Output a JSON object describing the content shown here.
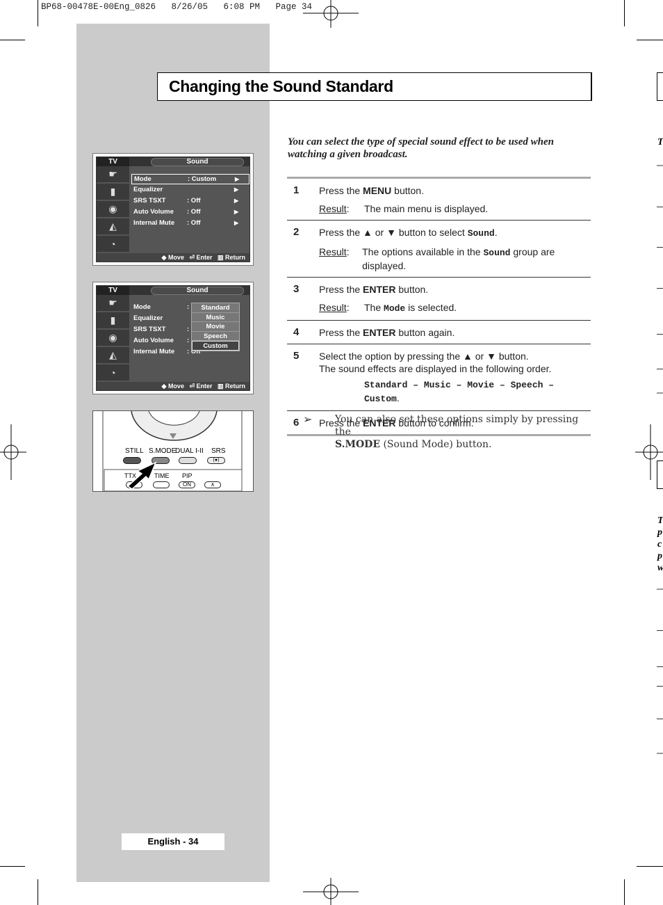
{
  "slug": "BP68-00478E-00Eng_0826   8/26/05   6:08 PM   Page 34",
  "title": "Changing the Sound Standard",
  "intro": "You can select the type of special sound effect to be used when watching a given broadcast.",
  "result_label": "Result",
  "steps": [
    {
      "num": "1",
      "line": [
        [
          "Press the ",
          ""
        ],
        [
          "MENU",
          "b"
        ],
        [
          " button.",
          ""
        ]
      ],
      "result": [
        [
          "The main menu is displayed.",
          ""
        ]
      ]
    },
    {
      "num": "2",
      "line": [
        [
          "Press the ▲ or ▼ button to select ",
          ""
        ],
        [
          "Sound",
          "m"
        ],
        [
          ".",
          ""
        ]
      ],
      "result": [
        [
          "The options available in the ",
          ""
        ],
        [
          "Sound",
          "m"
        ],
        [
          " group are displayed.",
          ""
        ]
      ]
    },
    {
      "num": "3",
      "line": [
        [
          "Press the ",
          ""
        ],
        [
          "ENTER",
          "b"
        ],
        [
          " button.",
          ""
        ]
      ],
      "result": [
        [
          "The ",
          ""
        ],
        [
          "Mode",
          "m"
        ],
        [
          " is selected.",
          ""
        ]
      ]
    },
    {
      "num": "4",
      "line": [
        [
          "Press the ",
          ""
        ],
        [
          "ENTER",
          "b"
        ],
        [
          " button again.",
          ""
        ]
      ]
    },
    {
      "num": "5",
      "line": [
        [
          "Select the option by pressing the ▲ or ▼ button.",
          ""
        ]
      ],
      "line2": "The sound effects are displayed in the following order.",
      "order": "Standard – Music – Movie – Speech – Custom",
      "order_end": "."
    },
    {
      "num": "6",
      "line": [
        [
          "Press the ",
          ""
        ],
        [
          "ENTER",
          "b"
        ],
        [
          " button to confirm.",
          ""
        ]
      ]
    }
  ],
  "note": {
    "icon": "arrowhead-icon",
    "text1": "You can also set these options simply by pressing the",
    "bold": "S.MODE",
    "text2": " (Sound Mode) button."
  },
  "menu1": {
    "tv": "TV",
    "tab": "Sound",
    "rows": [
      {
        "label": "Mode",
        "value": ": Custom"
      },
      {
        "label": "Equalizer",
        "value": ""
      },
      {
        "label": "SRS TSXT",
        "value": ": Off"
      },
      {
        "label": "Auto Volume",
        "value": ": Off"
      },
      {
        "label": "Internal Mute",
        "value": ": Off"
      }
    ],
    "footer": "◆ Move   ⏎ Enter   ▥ Return"
  },
  "menu2": {
    "tv": "TV",
    "tab": "Sound",
    "rows": [
      {
        "label": "Mode",
        "value": ":"
      },
      {
        "label": "Equalizer",
        "value": ""
      },
      {
        "label": "SRS TSXT",
        "value": ":"
      },
      {
        "label": "Auto Volume",
        "value": ":"
      },
      {
        "label": "Internal Mute",
        "value": ": Off"
      }
    ],
    "options": [
      "Standard",
      "Music",
      "Movie",
      "Speech",
      "Custom"
    ],
    "selected": "Custom",
    "footer": "◆ Move   ⏎ Enter   ▥ Return"
  },
  "remote": {
    "buttons": [
      "STILL",
      "S.MODE",
      "DUAL I-II",
      "SRS"
    ],
    "row2": [
      "TTX",
      "TIME",
      "PIP"
    ],
    "pip_label": "ON"
  },
  "page_label": "English - 34",
  "edge_fragments": [
    "T",
    "T",
    "p",
    "c",
    "p",
    "w"
  ]
}
